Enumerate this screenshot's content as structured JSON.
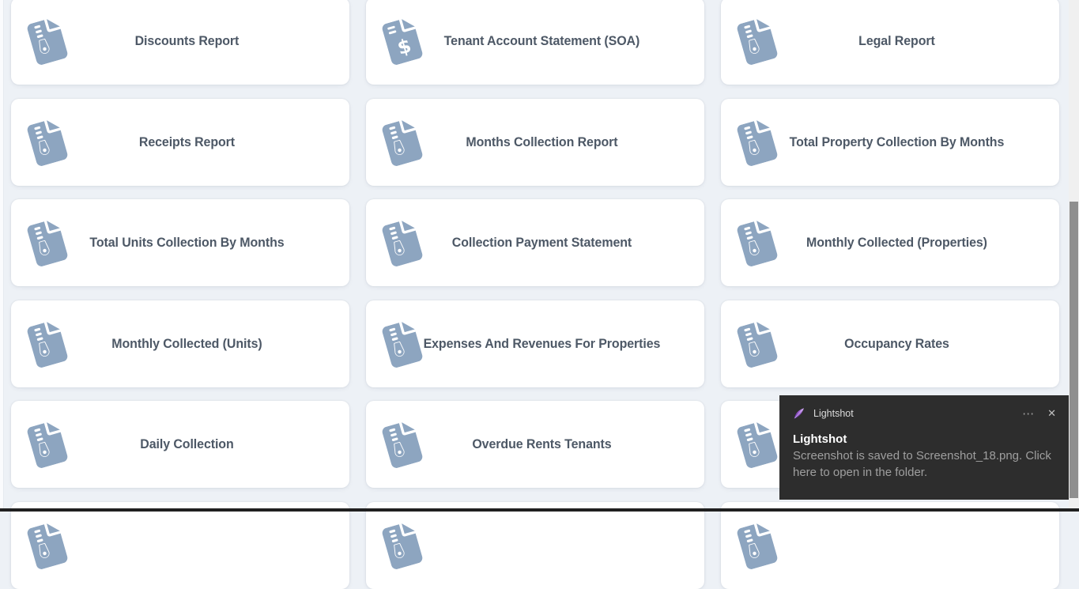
{
  "page": {
    "background_color": "#edf1f6",
    "bottom_bar_color": "#202020"
  },
  "report_grid": {
    "icon_color": "#8da5c0",
    "label_color": "#4d5866",
    "cards": [
      {
        "label": "Discounts Report",
        "icon": "file-zipper-icon"
      },
      {
        "label": "Tenant Account Statement (SOA)",
        "icon": "file-invoice-dollar-icon"
      },
      {
        "label": "Legal Report",
        "icon": "file-zipper-icon"
      },
      {
        "label": "Receipts Report",
        "icon": "file-zipper-icon"
      },
      {
        "label": "Months Collection Report",
        "icon": "file-zipper-icon"
      },
      {
        "label": "Total Property Collection By Months",
        "icon": "file-zipper-icon"
      },
      {
        "label": "Total Units Collection By Months",
        "icon": "file-zipper-icon"
      },
      {
        "label": "Collection Payment Statement",
        "icon": "file-zipper-icon"
      },
      {
        "label": "Monthly Collected (Properties)",
        "icon": "file-zipper-icon"
      },
      {
        "label": "Monthly Collected (Units)",
        "icon": "file-zipper-icon"
      },
      {
        "label": "Expenses And Revenues For Properties",
        "icon": "file-zipper-icon"
      },
      {
        "label": "Occupancy Rates",
        "icon": "file-zipper-icon"
      },
      {
        "label": "Daily Collection",
        "icon": "file-zipper-icon"
      },
      {
        "label": "Overdue Rents Tenants",
        "icon": "file-zipper-icon"
      },
      {
        "label": "",
        "icon": "file-zipper-icon"
      },
      {
        "label": "",
        "icon": "file-zipper-icon",
        "cut_off": true
      },
      {
        "label": "",
        "icon": "file-zipper-icon",
        "cut_off": true
      },
      {
        "label": "",
        "icon": "file-zipper-icon",
        "cut_off": true
      }
    ]
  },
  "toast": {
    "app_name": "Lightshot",
    "title": "Lightshot",
    "message": "Screenshot is saved to Screenshot_18.png. Click here to open in the folder.",
    "more_button": "⋯",
    "close_button": "✕",
    "background_color": "#2d2d2d",
    "feather_color": "#8e4fc9"
  }
}
